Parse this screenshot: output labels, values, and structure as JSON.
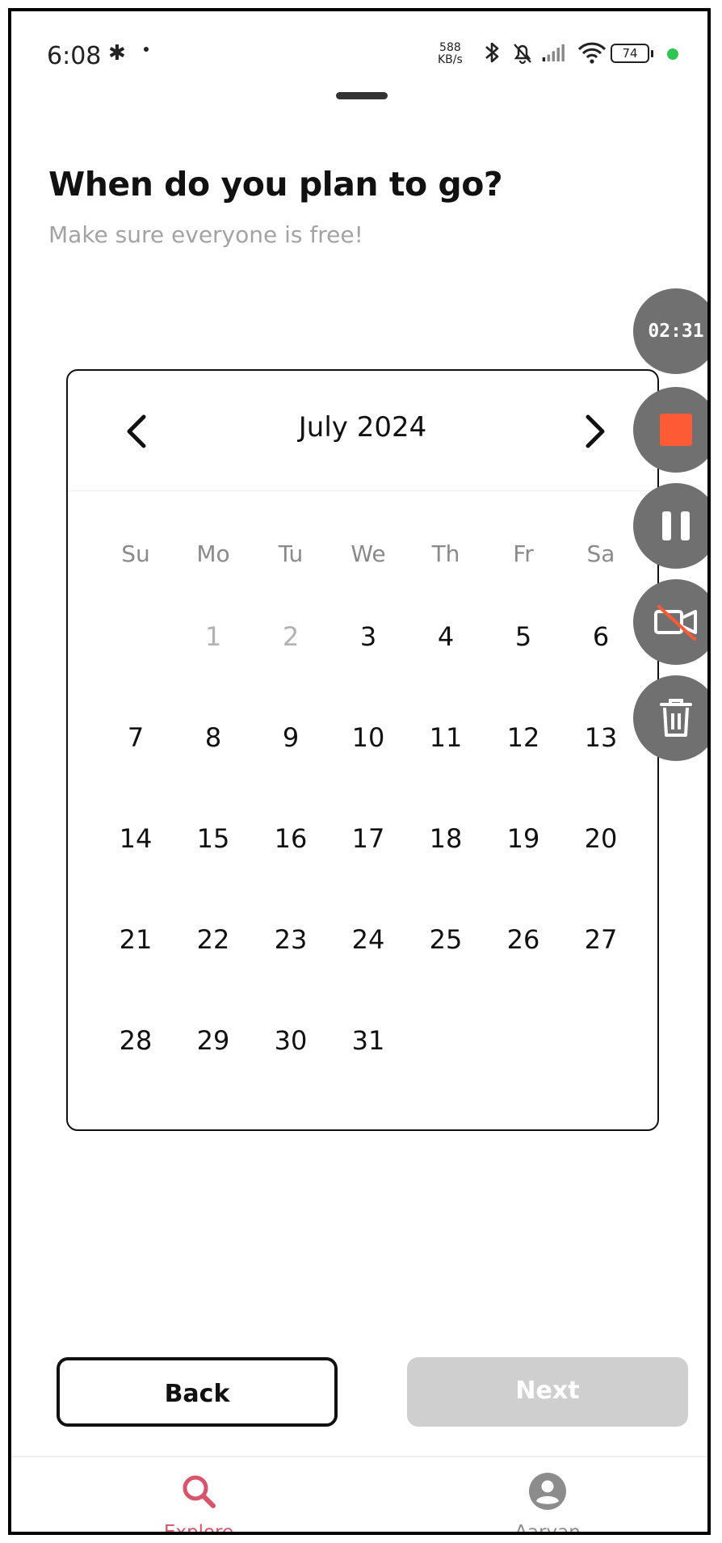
{
  "status_bar": {
    "time": "6:08",
    "network_speed_value": "588",
    "network_speed_unit": "KB/s",
    "battery": "74",
    "icons": [
      "bluetooth-icon",
      "notification-dot",
      "bluetooth-icon",
      "bell-muted-icon",
      "signal-icon",
      "wifi-icon",
      "battery-icon",
      "camera-active-dot"
    ]
  },
  "page": {
    "title": "When do you plan to go?",
    "subtitle": "Make sure everyone is free!"
  },
  "calendar": {
    "month_label": "July 2024",
    "prev_icon": "chevron-left-icon",
    "next_icon": "chevron-right-icon",
    "weekdays": [
      "Su",
      "Mo",
      "Tu",
      "We",
      "Th",
      "Fr",
      "Sa"
    ],
    "weeks": [
      [
        {
          "d": ""
        },
        {
          "d": "1",
          "disabled": true
        },
        {
          "d": "2",
          "disabled": true
        },
        {
          "d": "3"
        },
        {
          "d": "4"
        },
        {
          "d": "5"
        },
        {
          "d": "6"
        }
      ],
      [
        {
          "d": "7"
        },
        {
          "d": "8"
        },
        {
          "d": "9"
        },
        {
          "d": "10"
        },
        {
          "d": "11"
        },
        {
          "d": "12"
        },
        {
          "d": "13"
        }
      ],
      [
        {
          "d": "14"
        },
        {
          "d": "15"
        },
        {
          "d": "16"
        },
        {
          "d": "17"
        },
        {
          "d": "18"
        },
        {
          "d": "19"
        },
        {
          "d": "20"
        }
      ],
      [
        {
          "d": "21"
        },
        {
          "d": "22"
        },
        {
          "d": "23"
        },
        {
          "d": "24"
        },
        {
          "d": "25"
        },
        {
          "d": "26"
        },
        {
          "d": "27"
        }
      ],
      [
        {
          "d": "28"
        },
        {
          "d": "29"
        },
        {
          "d": "30"
        },
        {
          "d": "31"
        },
        {
          "d": ""
        },
        {
          "d": ""
        },
        {
          "d": ""
        }
      ]
    ]
  },
  "recorder": {
    "timer": "02:31",
    "controls": [
      "stop-icon",
      "pause-icon",
      "camera-off-icon",
      "trash-icon"
    ],
    "stop_color": "#ff5a36"
  },
  "actions": {
    "back_label": "Back",
    "next_label": "Next"
  },
  "bottom_nav": {
    "items": [
      {
        "label": "Explore",
        "icon": "search-icon",
        "active": true
      },
      {
        "label": "Aaryan",
        "icon": "account-icon",
        "active": false
      }
    ],
    "active_color": "#d9536a"
  }
}
